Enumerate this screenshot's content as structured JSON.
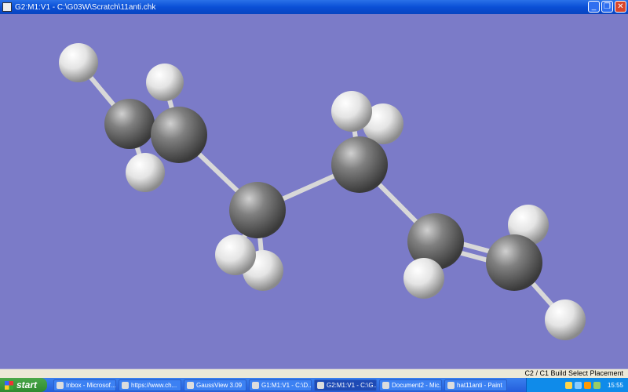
{
  "window": {
    "title": "G2:M1:V1 - C:\\G03W\\Scratch\\11anti.chk",
    "buttons": [
      "minimize",
      "restore",
      "close"
    ]
  },
  "viewport": {
    "background": "#7b7bc8",
    "atom_colors": {
      "C": "#808080",
      "H": "#e8e8e8"
    }
  },
  "statusbar": {
    "text": "C2 / C1  Build  Select Placement"
  },
  "taskbar": {
    "start": "start",
    "tasks": [
      {
        "label": "Inbox - Microsof...",
        "icon": "outlook-icon"
      },
      {
        "label": "https://www.ch...",
        "icon": "ie-icon"
      },
      {
        "label": "GaussView 3.09",
        "icon": "gaussview-icon"
      },
      {
        "label": "G1:M1:V1 - C:\\D...",
        "icon": "gaussview-window-icon"
      },
      {
        "label": "G2:M1:V1 - C:\\G...",
        "icon": "gaussview-window-icon",
        "active": true
      },
      {
        "label": "Document2 - Mic...",
        "icon": "word-icon"
      },
      {
        "label": "hat11anti - Paint",
        "icon": "paint-icon"
      }
    ],
    "clock": "15:55"
  }
}
